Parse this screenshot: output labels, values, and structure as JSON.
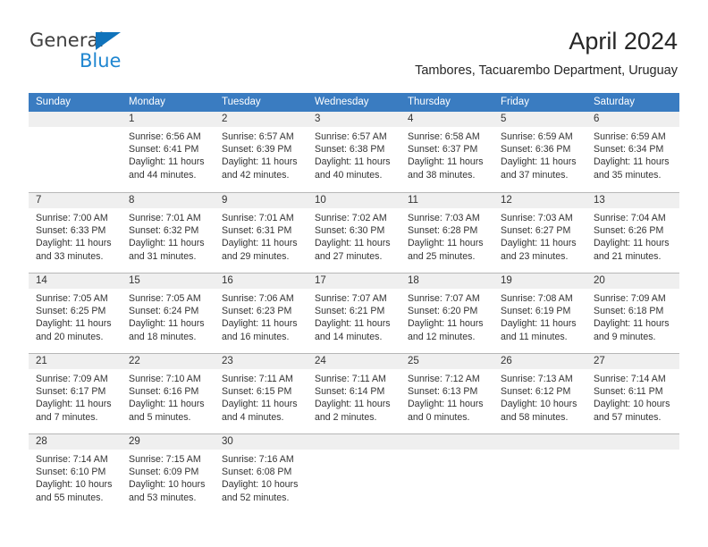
{
  "brand": {
    "name_part1": "General",
    "name_part2": "Blue",
    "accent_color": "#1f86d0",
    "triangle_color": "#1073bb"
  },
  "header": {
    "title": "April 2024",
    "subtitle": "Tambores, Tacuarembo Department, Uruguay"
  },
  "calendar": {
    "header_bg": "#3a7cc1",
    "day_band_bg": "#efefef",
    "weekdays": [
      "Sunday",
      "Monday",
      "Tuesday",
      "Wednesday",
      "Thursday",
      "Friday",
      "Saturday"
    ],
    "weeks": [
      [
        {
          "day": "",
          "lines": []
        },
        {
          "day": "1",
          "lines": [
            "Sunrise: 6:56 AM",
            "Sunset: 6:41 PM",
            "Daylight: 11 hours",
            "and 44 minutes."
          ]
        },
        {
          "day": "2",
          "lines": [
            "Sunrise: 6:57 AM",
            "Sunset: 6:39 PM",
            "Daylight: 11 hours",
            "and 42 minutes."
          ]
        },
        {
          "day": "3",
          "lines": [
            "Sunrise: 6:57 AM",
            "Sunset: 6:38 PM",
            "Daylight: 11 hours",
            "and 40 minutes."
          ]
        },
        {
          "day": "4",
          "lines": [
            "Sunrise: 6:58 AM",
            "Sunset: 6:37 PM",
            "Daylight: 11 hours",
            "and 38 minutes."
          ]
        },
        {
          "day": "5",
          "lines": [
            "Sunrise: 6:59 AM",
            "Sunset: 6:36 PM",
            "Daylight: 11 hours",
            "and 37 minutes."
          ]
        },
        {
          "day": "6",
          "lines": [
            "Sunrise: 6:59 AM",
            "Sunset: 6:34 PM",
            "Daylight: 11 hours",
            "and 35 minutes."
          ]
        }
      ],
      [
        {
          "day": "7",
          "lines": [
            "Sunrise: 7:00 AM",
            "Sunset: 6:33 PM",
            "Daylight: 11 hours",
            "and 33 minutes."
          ]
        },
        {
          "day": "8",
          "lines": [
            "Sunrise: 7:01 AM",
            "Sunset: 6:32 PM",
            "Daylight: 11 hours",
            "and 31 minutes."
          ]
        },
        {
          "day": "9",
          "lines": [
            "Sunrise: 7:01 AM",
            "Sunset: 6:31 PM",
            "Daylight: 11 hours",
            "and 29 minutes."
          ]
        },
        {
          "day": "10",
          "lines": [
            "Sunrise: 7:02 AM",
            "Sunset: 6:30 PM",
            "Daylight: 11 hours",
            "and 27 minutes."
          ]
        },
        {
          "day": "11",
          "lines": [
            "Sunrise: 7:03 AM",
            "Sunset: 6:28 PM",
            "Daylight: 11 hours",
            "and 25 minutes."
          ]
        },
        {
          "day": "12",
          "lines": [
            "Sunrise: 7:03 AM",
            "Sunset: 6:27 PM",
            "Daylight: 11 hours",
            "and 23 minutes."
          ]
        },
        {
          "day": "13",
          "lines": [
            "Sunrise: 7:04 AM",
            "Sunset: 6:26 PM",
            "Daylight: 11 hours",
            "and 21 minutes."
          ]
        }
      ],
      [
        {
          "day": "14",
          "lines": [
            "Sunrise: 7:05 AM",
            "Sunset: 6:25 PM",
            "Daylight: 11 hours",
            "and 20 minutes."
          ]
        },
        {
          "day": "15",
          "lines": [
            "Sunrise: 7:05 AM",
            "Sunset: 6:24 PM",
            "Daylight: 11 hours",
            "and 18 minutes."
          ]
        },
        {
          "day": "16",
          "lines": [
            "Sunrise: 7:06 AM",
            "Sunset: 6:23 PM",
            "Daylight: 11 hours",
            "and 16 minutes."
          ]
        },
        {
          "day": "17",
          "lines": [
            "Sunrise: 7:07 AM",
            "Sunset: 6:21 PM",
            "Daylight: 11 hours",
            "and 14 minutes."
          ]
        },
        {
          "day": "18",
          "lines": [
            "Sunrise: 7:07 AM",
            "Sunset: 6:20 PM",
            "Daylight: 11 hours",
            "and 12 minutes."
          ]
        },
        {
          "day": "19",
          "lines": [
            "Sunrise: 7:08 AM",
            "Sunset: 6:19 PM",
            "Daylight: 11 hours",
            "and 11 minutes."
          ]
        },
        {
          "day": "20",
          "lines": [
            "Sunrise: 7:09 AM",
            "Sunset: 6:18 PM",
            "Daylight: 11 hours",
            "and 9 minutes."
          ]
        }
      ],
      [
        {
          "day": "21",
          "lines": [
            "Sunrise: 7:09 AM",
            "Sunset: 6:17 PM",
            "Daylight: 11 hours",
            "and 7 minutes."
          ]
        },
        {
          "day": "22",
          "lines": [
            "Sunrise: 7:10 AM",
            "Sunset: 6:16 PM",
            "Daylight: 11 hours",
            "and 5 minutes."
          ]
        },
        {
          "day": "23",
          "lines": [
            "Sunrise: 7:11 AM",
            "Sunset: 6:15 PM",
            "Daylight: 11 hours",
            "and 4 minutes."
          ]
        },
        {
          "day": "24",
          "lines": [
            "Sunrise: 7:11 AM",
            "Sunset: 6:14 PM",
            "Daylight: 11 hours",
            "and 2 minutes."
          ]
        },
        {
          "day": "25",
          "lines": [
            "Sunrise: 7:12 AM",
            "Sunset: 6:13 PM",
            "Daylight: 11 hours",
            "and 0 minutes."
          ]
        },
        {
          "day": "26",
          "lines": [
            "Sunrise: 7:13 AM",
            "Sunset: 6:12 PM",
            "Daylight: 10 hours",
            "and 58 minutes."
          ]
        },
        {
          "day": "27",
          "lines": [
            "Sunrise: 7:14 AM",
            "Sunset: 6:11 PM",
            "Daylight: 10 hours",
            "and 57 minutes."
          ]
        }
      ],
      [
        {
          "day": "28",
          "lines": [
            "Sunrise: 7:14 AM",
            "Sunset: 6:10 PM",
            "Daylight: 10 hours",
            "and 55 minutes."
          ]
        },
        {
          "day": "29",
          "lines": [
            "Sunrise: 7:15 AM",
            "Sunset: 6:09 PM",
            "Daylight: 10 hours",
            "and 53 minutes."
          ]
        },
        {
          "day": "30",
          "lines": [
            "Sunrise: 7:16 AM",
            "Sunset: 6:08 PM",
            "Daylight: 10 hours",
            "and 52 minutes."
          ]
        },
        {
          "day": "",
          "lines": []
        },
        {
          "day": "",
          "lines": []
        },
        {
          "day": "",
          "lines": []
        },
        {
          "day": "",
          "lines": []
        }
      ]
    ]
  }
}
